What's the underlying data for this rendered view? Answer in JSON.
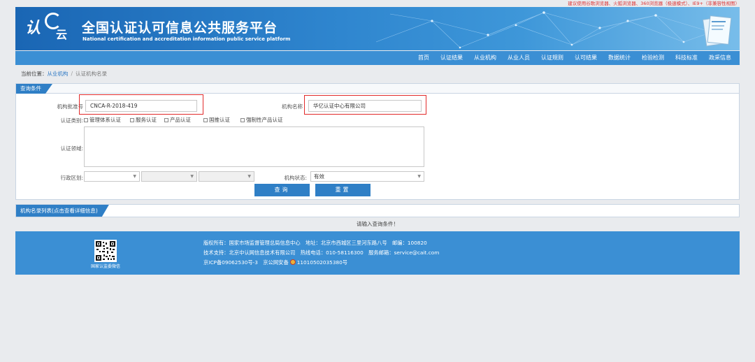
{
  "top_notice": "建议使用谷歌浏览器、火狐浏览器、360浏览器（极速模式）、IE9+（非兼容性视图）",
  "header": {
    "logo_text": "认",
    "logo_sub": "云",
    "title": "全国认证认可信息公共服务平台",
    "subtitle": "National certification and accreditation information public service platform"
  },
  "nav": {
    "items": [
      "首页",
      "认证结果",
      "从业机构",
      "从业人员",
      "认证规则",
      "认可结果",
      "数据统计",
      "检验检测",
      "科技标准",
      "政采信息"
    ]
  },
  "breadcrumb": {
    "prefix": "当前位置：",
    "link": "从业机构",
    "separator": "/",
    "current": "认证机构名录"
  },
  "query_panel": {
    "title": "查询条件",
    "approval_no_label": "机构批准号",
    "approval_no_value": "CNCA-R-2018-419",
    "org_name_label": "机构名称",
    "org_name_value": "华亿认证中心有限公司",
    "cert_type_label": "认证类别:",
    "cert_types": [
      "管理体系认证",
      "服务认证",
      "产品认证",
      "国推认证",
      "强制性产品认证"
    ],
    "cert_field_label": "认证领域:",
    "region_label": "行政区划:",
    "status_label": "机构状态:",
    "status_value": "有效",
    "search_button": "查询",
    "reset_button": "重置"
  },
  "result_panel": {
    "title": "机构名录列表(点击查看详细信息)",
    "hint": "请输入查询条件！"
  },
  "footer": {
    "qr_caption": "国家认监委微信",
    "line1": "版权所有：国家市场监督管理总局信息中心　地址：北京市西城区三里河东路八号　邮编：100820",
    "line2": "技术支持：北京中认网信息技术有限公司　热线电话：010-58116300　服务邮箱：service@cait.com",
    "icp": "京ICP备09062530号-3",
    "police_prefix": "京公网安备",
    "police_no": "11010502035380号"
  },
  "colors": {
    "primary": "#2f7fc6",
    "nav": "#3b8fd4",
    "highlight_border": "#e12a2a",
    "notice": "#dd3333"
  }
}
